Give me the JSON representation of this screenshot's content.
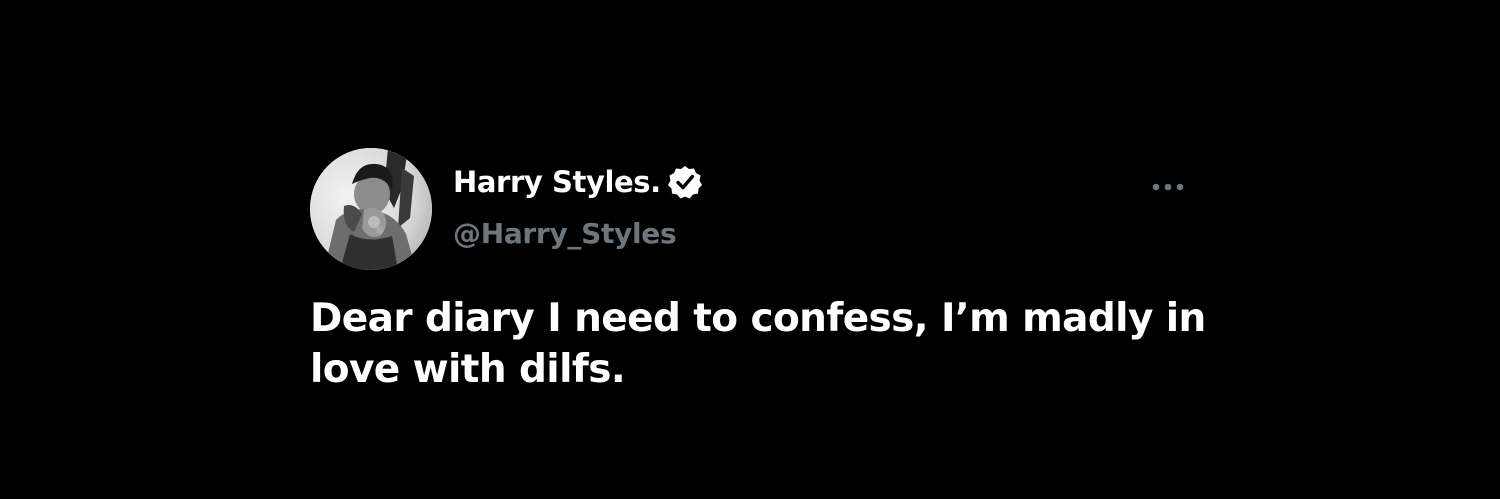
{
  "tweet": {
    "author_name": "Harry Styles.",
    "author_handle": "@Harry_Styles",
    "text": "Dear diary I need to confess, I’m madly in love with dilfs.",
    "verified": true
  },
  "icons": {
    "avatar": "profile-photo",
    "verified": "verified-badge-icon",
    "more": "more-options-icon"
  },
  "colors": {
    "background": "#000000",
    "name": "#ffffff",
    "handle": "#6e767d",
    "text": "#ffffff",
    "more": "#6e767d"
  }
}
